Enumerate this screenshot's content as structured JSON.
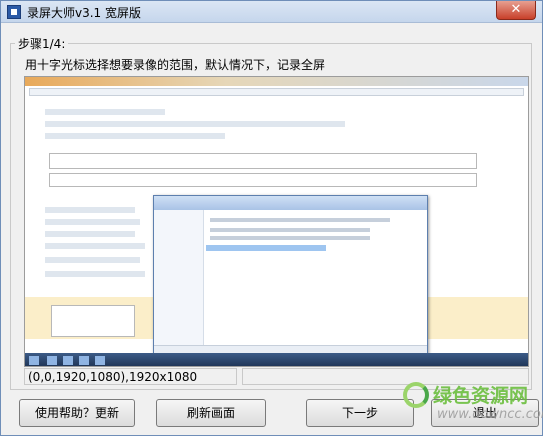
{
  "window": {
    "title": "录屏大师v3.1 宽屏版",
    "close_label": "✕"
  },
  "step": {
    "label": "步骤1/4:",
    "instruction": "用十字光标选择想要录像的范围，默认情况下，记录全屏"
  },
  "status": {
    "region": "(0,0,1920,1080),1920x1080",
    "secondary": ""
  },
  "buttons": {
    "help": "使用帮助？更新",
    "refresh": "刷新画面",
    "next": "下一步",
    "exit": "退出"
  },
  "watermark": {
    "brand": "绿色资源网",
    "url": "www.downcc.com"
  },
  "colors": {
    "title_bar": "#c5d6ec",
    "close_button": "#c8402a",
    "watermark_green": "#6cbf3f"
  }
}
